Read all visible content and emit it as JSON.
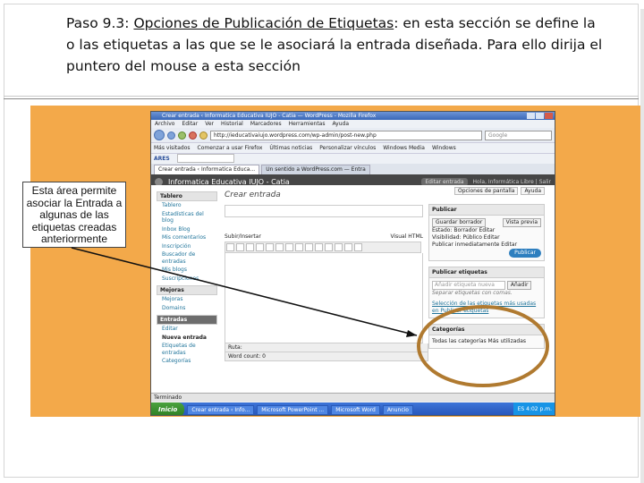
{
  "heading": {
    "prefix": "Paso 9.3: ",
    "underlined": "Opciones de Publicación de Etiquetas",
    "rest": ": en esta sección se  define la o las etiquetas a las que se le asociará la entrada diseñada. Para ello dirija el puntero del mouse a esta sección"
  },
  "callout": {
    "text": "Esta área permite asociar la Entrada a algunas de las etiquetas creadas anteriormente"
  },
  "colors": {
    "band": "#f3a94a",
    "highlight_ellipse": "#b07a30",
    "arrow": "#111111"
  },
  "browser": {
    "window_title": "Crear entrada ‹ Informatica Educativa IUJO - Catia — WordPress - Mozilla Firefox",
    "menu": [
      "Archivo",
      "Editar",
      "Ver",
      "Historial",
      "Marcadores",
      "Herramientas",
      "Ayuda"
    ],
    "url": "http://ieducativaiujo.wordpress.com/wp-admin/post-new.php",
    "search_placeholder": "Google",
    "bookmarks": [
      "Más visitados",
      "Comenzar a usar Firefox",
      "Últimas noticias",
      "Personalizar vínculos",
      "Windows Media",
      "Windows"
    ],
    "search_label": "ARES",
    "tabs": [
      "Crear entrada ‹ Informatica Educa...",
      "Un sentido a WordPress.com — Entra"
    ],
    "status": "Terminado"
  },
  "wp": {
    "site_name": "Informatica Educativa IUJO - Catia",
    "edit_pill": "Editar entrada",
    "howdy": "Hola, Informática Libre | Salir",
    "page_title": "Crear entrada",
    "screen_options": [
      "Opciones de pantalla",
      "Ayuda"
    ],
    "upload_label": "Subir/Insertar",
    "editor_modes": [
      "Visual",
      "HTML"
    ],
    "word_count": "Word count: 0",
    "path_label": "Ruta:",
    "sidebar": {
      "dashboard_header": "Tablero",
      "dashboard_items": [
        "Tablero",
        "Estadísticas del blog",
        "Inbox Blog",
        "Mis comentarios",
        "Inscripción",
        "Buscador de entradas",
        "Mis blogs",
        "Suscripciones"
      ],
      "upgrades_header": "Mejoras",
      "upgrades_items": [
        "Mejoras",
        "Domains"
      ],
      "posts_header": "Entradas",
      "posts_items": [
        "Editar",
        "Nueva entrada",
        "Etiquetas de entradas",
        "Categorías"
      ]
    },
    "publish": {
      "header": "Publicar",
      "save_draft": "Guardar borrador",
      "preview": "Vista previa",
      "status_line": "Estado: Borrador Editar",
      "visibility_line": "Visibilidad: Público Editar",
      "publish_line": "Publicar inmediatamente Editar",
      "publish_button": "Publicar"
    },
    "tags": {
      "header": "Publicar etiquetas",
      "placeholder": "Añadir etiqueta nueva",
      "add_button": "Añadir",
      "hint": "Separar etiquetas con comas.",
      "link": "Selección de las etiquetas más usadas en Publicar etiquetas"
    },
    "categories": {
      "header": "Categorías",
      "tabs_line": "Todas las categorías  Más utilizadas"
    }
  },
  "taskbar": {
    "start": "Inicio",
    "tasks": [
      "Crear entrada ‹ Info...",
      "Microsoft PowerPoint ...",
      "Microsoft Word",
      "Anuncio"
    ],
    "tray_time": "4:02 p.m.",
    "language": "ES"
  }
}
